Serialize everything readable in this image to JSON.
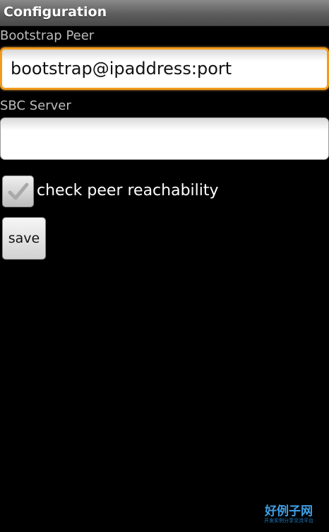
{
  "window": {
    "title": "Configuration"
  },
  "form": {
    "bootstrap_peer": {
      "label": "Bootstrap Peer",
      "value": "bootstrap@ipaddress:port"
    },
    "sbc_server": {
      "label": "SBC Server",
      "value": ""
    },
    "check_peer": {
      "label": "check peer reachability",
      "checked": false
    },
    "save_label": "save"
  },
  "watermark": {
    "main": "好例子网",
    "sub": "开发实例分享交流平台"
  },
  "colors": {
    "background": "#000000",
    "focus_border": "#f39a1b",
    "label_text": "#bdbdbd"
  }
}
